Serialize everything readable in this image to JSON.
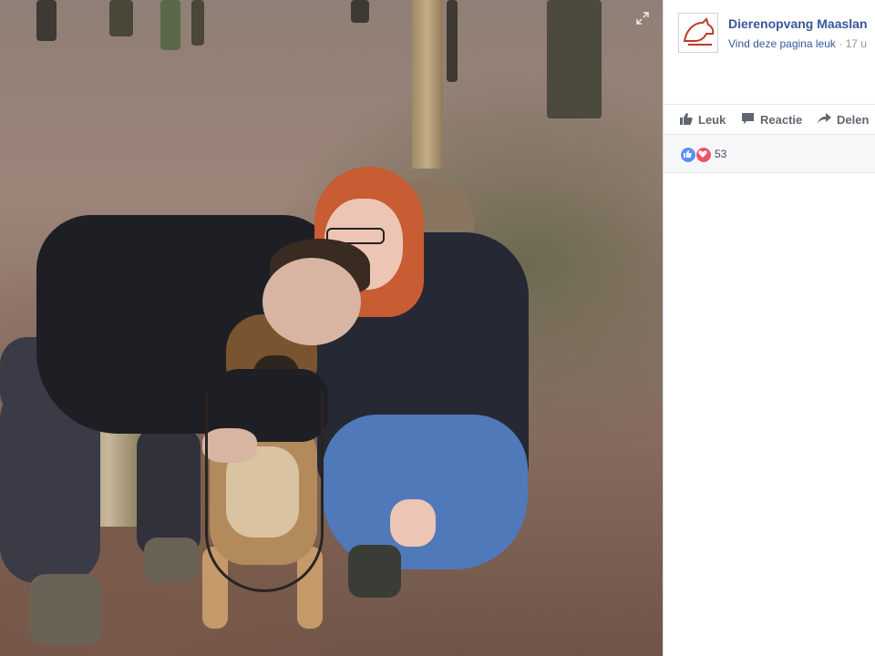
{
  "page": {
    "name": "Dierenopvang Maaslan",
    "like_prompt": "Vind deze pagina leuk",
    "separator": "·",
    "time": "17 u"
  },
  "actions": {
    "like_label": "Leuk",
    "comment_label": "Reactie",
    "share_label": "Delen"
  },
  "reactions": {
    "count": "53",
    "types": [
      "like-icon",
      "love-icon"
    ]
  },
  "colors": {
    "link": "#365899",
    "like": "#5890ff",
    "love": "#f25268"
  }
}
